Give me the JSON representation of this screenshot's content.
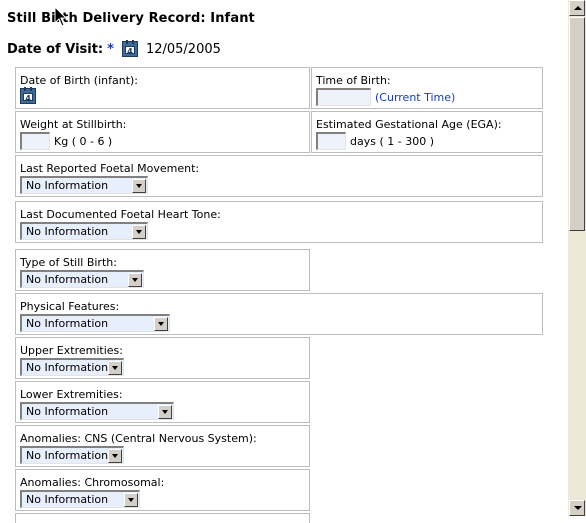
{
  "page": {
    "title": "Still Birth Delivery Record: Infant",
    "visit_label": "Date of Visit:",
    "required_mark": "*",
    "visit_date": "12/05/2005",
    "calendar_icon": "calendar-icon"
  },
  "fields": {
    "dob_label": "Date of Birth (infant):",
    "time_label": "Time of Birth:",
    "time_value": "",
    "current_time_link": "(Current Time)",
    "weight_label": "Weight at Stillbirth:",
    "weight_value": "",
    "weight_unit": "Kg ( 0 - 6 )",
    "ega_label": "Estimated Gestational Age (EGA):",
    "ega_value": "",
    "ega_unit": "days ( 1 - 300 )",
    "foetal_movement_label": "Last Reported Foetal Movement:",
    "foetal_movement_value": "No Information",
    "heart_tone_label": "Last Documented Foetal Heart Tone:",
    "heart_tone_value": "No Information",
    "type_label": "Type of Still Birth:",
    "type_value": "No Information",
    "physical_label": "Physical Features:",
    "physical_value": "No Information",
    "upper_label": "Upper Extremities:",
    "upper_value": "No Information",
    "lower_label": "Lower Extremities:",
    "lower_value": "No Information",
    "cns_label": "Anomalies: CNS (Central Nervous System):",
    "cns_value": "No Information",
    "chromosomal_label": "Anomalies: Chromosomal:",
    "chromosomal_value": "No Information"
  },
  "colors": {
    "required_mark": "#1a3ea8",
    "link": "#1a3ea8",
    "field_background": "#e8effc",
    "box_border": "#bdbdbd"
  }
}
